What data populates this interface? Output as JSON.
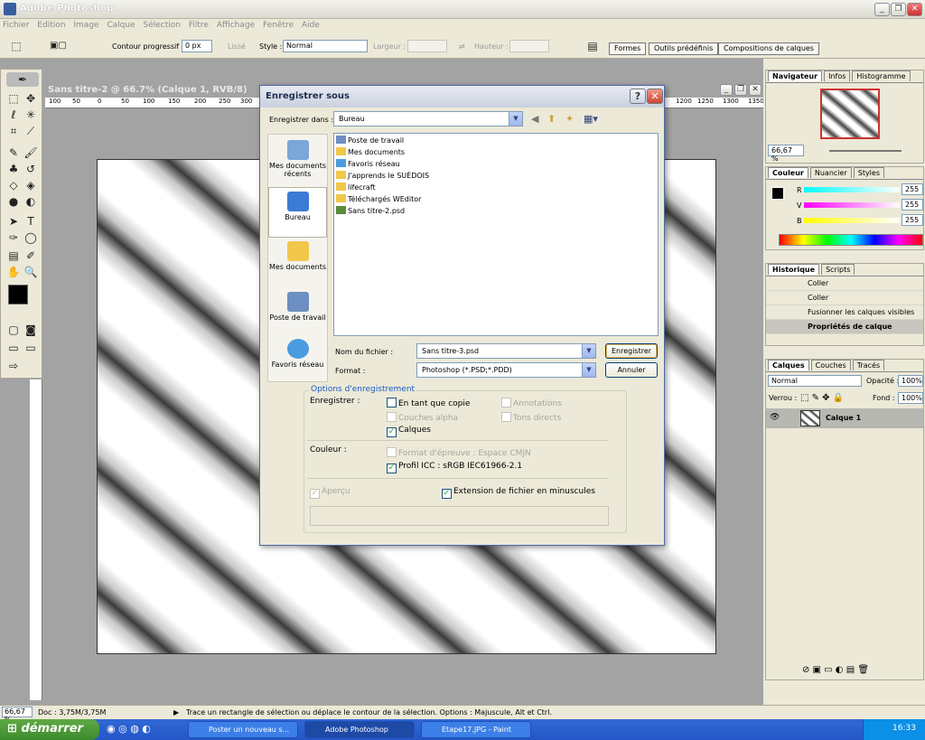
{
  "app": {
    "title": "Adobe Photoshop"
  },
  "menu": [
    "Fichier",
    "Edition",
    "Image",
    "Calque",
    "Sélection",
    "Filtre",
    "Affichage",
    "Fenêtre",
    "Aide"
  ],
  "options": {
    "contour_label": "Contour progressif :",
    "contour_value": "0 px",
    "lisse": "Lissé",
    "style_label": "Style :",
    "style_value": "Normal",
    "largeur": "Largeur :",
    "hauteur": "Hauteur :",
    "tabs": [
      "Formes",
      "Outils prédéfinis",
      "Compositions de calques"
    ]
  },
  "document": {
    "title": "Sans titre-2 @ 66.7% (Calque 1, RVB/8)",
    "ruler_marks": [
      "100",
      "50",
      "0",
      "50",
      "100",
      "150",
      "200",
      "250",
      "300"
    ],
    "ruler_marks_right": [
      "1200",
      "1250",
      "1300",
      "1350"
    ]
  },
  "dialog": {
    "title": "Enregistrer sous",
    "save_in_label": "Enregistrer dans :",
    "save_in_value": "Bureau",
    "places": [
      "Mes documents récents",
      "Bureau",
      "Mes documents",
      "Poste de travail",
      "Favoris réseau"
    ],
    "files": [
      "Poste de travail",
      "Mes documents",
      "Favoris réseau",
      "J'apprends le SUÉDOIS",
      "lifecraft",
      "Téléchargés WEditor",
      "Sans titre-2.psd"
    ],
    "filename_label": "Nom du fichier :",
    "filename_value": "Sans titre-3.psd",
    "format_label": "Format :",
    "format_value": "Photoshop (*.PSD;*.PDD)",
    "save_button": "Enregistrer",
    "cancel_button": "Annuler",
    "options_title": "Options d'enregistrement",
    "save_label": "Enregistrer :",
    "cb_copy": "En tant que copie",
    "cb_annotations": "Annotations",
    "cb_alpha": "Couches alpha",
    "cb_spot": "Tons directs",
    "cb_layers": "Calques",
    "color_label": "Couleur :",
    "cb_proof": "Format d'épreuve : Espace CMJN",
    "cb_icc": "Profil ICC : sRGB IEC61966-2.1",
    "cb_preview": "Aperçu",
    "cb_extension": "Extension de fichier en minuscules"
  },
  "navigator": {
    "tabs": [
      "Navigateur",
      "Infos",
      "Histogramme"
    ],
    "zoom": "66,67 %"
  },
  "color": {
    "tabs": [
      "Couleur",
      "Nuancier",
      "Styles"
    ],
    "r_label": "R",
    "v_label": "V",
    "b_label": "B",
    "r": "255",
    "v": "255",
    "b": "255"
  },
  "history": {
    "tabs": [
      "Historique",
      "Scripts"
    ],
    "rows": [
      "Coller",
      "Coller",
      "Fusionner les calques visibles",
      "Propriétés de calque"
    ]
  },
  "layers": {
    "tabs": [
      "Calques",
      "Couches",
      "Tracés"
    ],
    "mode": "Normal",
    "opacity_label": "Opacité :",
    "opacity": "100%",
    "lock_label": "Verrou :",
    "fill_label": "Fond :",
    "fill": "100%",
    "layer_name": "Calque 1"
  },
  "status": {
    "zoom": "66,67 %",
    "doc": "Doc : 3,75M/3,75M",
    "hint": "Trace un rectangle de sélection ou déplace le contour de la sélection. Options : Majuscule, Alt et Ctrl."
  },
  "taskbar": {
    "start": "démarrer",
    "tasks": [
      "Poster un nouveau s...",
      "Adobe Photoshop",
      "Etape17.JPG - Paint"
    ],
    "clock": "16:33"
  }
}
